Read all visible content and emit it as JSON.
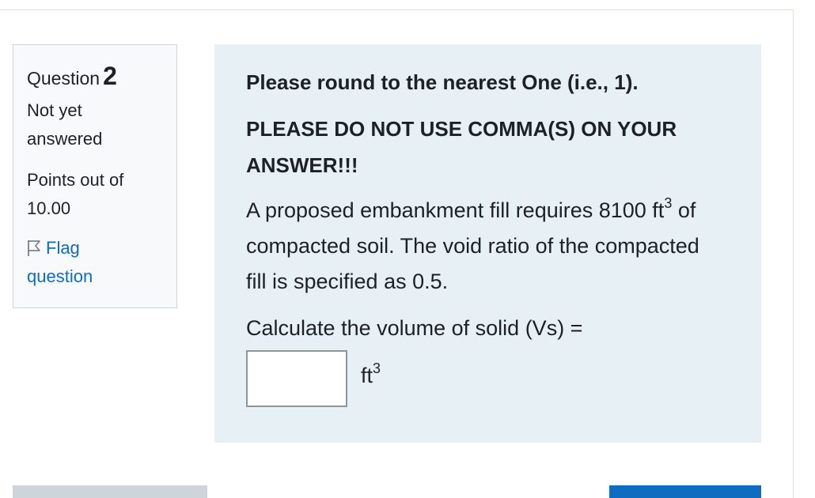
{
  "info": {
    "question_word": "Question",
    "question_number": "2",
    "state": [
      "Not yet",
      "answered"
    ],
    "grade": [
      "Points out of",
      "10.00"
    ],
    "flag": [
      "Flag",
      "question"
    ]
  },
  "content": {
    "round_note": "Please round to the nearest One (i.e., 1).",
    "comma_note": "PLEASE DO NOT USE COMMA(S) ON YOUR ANSWER!!!",
    "problem_part1": "A proposed embankment fill requires 8100 ft",
    "problem_sup": "3",
    "problem_part2": " of compacted soil. The void ratio of the compacted fill is specified as 0.5.",
    "calc_prompt": "Calculate the volume of solid (Vs) =",
    "answer_value": "",
    "unit_base": "ft",
    "unit_sup": "3"
  },
  "colors": {
    "link": "#0f6cbf",
    "content_bg": "#e7f1f5",
    "info_bg": "#f8f9fa",
    "next_button": "#0f6cbf",
    "prev_button": "#ced4da"
  },
  "icons": {
    "flag": "flag-outline-icon"
  }
}
